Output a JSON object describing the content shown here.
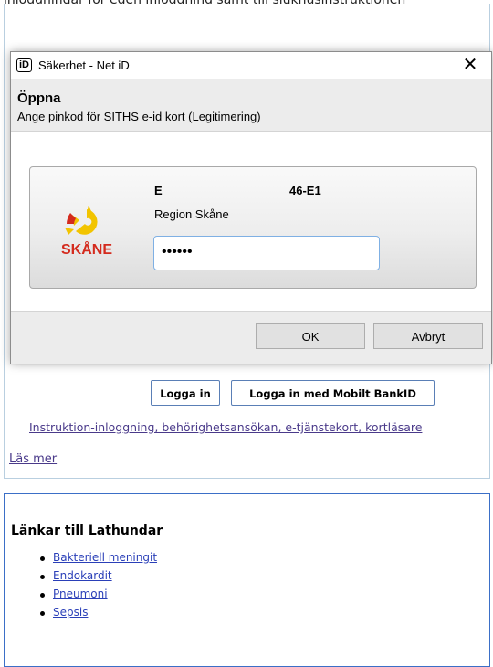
{
  "page": {
    "top_text": "inloggningar för egen inloggning samt till sjukhusinstruktionen",
    "login_button": "Logga in",
    "bankid_button": "Logga in med Mobilt BankID",
    "instruction_link": "Instruktion-inloggning, behörighetsansökan, e-tjänstekort, kortläsare",
    "read_more_link": "Läs mer"
  },
  "dialog": {
    "title": "Säkerhet - Net iD",
    "app_icon_text": "iD",
    "close_glyph": "✕",
    "header_title": "Öppna",
    "header_subtitle": "Ange pinkod för SITHS e-id kort (Legitimering)",
    "card": {
      "holder": "E",
      "id": "46-E1",
      "organization": "Region Skåne",
      "logo_text": "SKÅNE",
      "pin_mask": "••••••"
    },
    "ok_button": "OK",
    "cancel_button": "Avbryt"
  },
  "guides": {
    "title": "Länkar till Lathundar",
    "items": [
      "Bakteriell meningit",
      "Endokardit",
      "Pneumoni",
      "Sepsis"
    ]
  },
  "colors": {
    "skane_yellow": "#f2c400",
    "skane_red": "#d42b1e"
  }
}
